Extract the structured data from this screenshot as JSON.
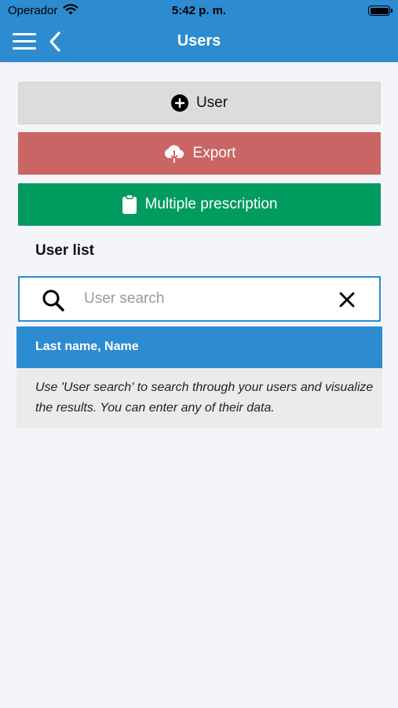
{
  "status_bar": {
    "carrier": "Operador",
    "time": "5:42 p. m."
  },
  "navbar": {
    "title": "Users"
  },
  "actions": {
    "user_label": "User",
    "export_label": "Export",
    "multiple_prescription_label": "Multiple prescription"
  },
  "user_list": {
    "title": "User list",
    "search_placeholder": "User search",
    "search_value": "",
    "column_header": "Last name, Name",
    "empty_message": "Use 'User search' to search through your users and visualize the results. You can enter any of their data."
  },
  "colors": {
    "primary": "#2d8bd0",
    "export": "#cb6464",
    "multiple_prescription": "#009b5f",
    "user_button": "#dcdcdc"
  },
  "icons": [
    "wifi-icon",
    "battery-icon",
    "menu-icon",
    "back-icon",
    "add-circle-icon",
    "cloud-download-icon",
    "clipboard-icon",
    "search-icon",
    "clear-icon"
  ]
}
